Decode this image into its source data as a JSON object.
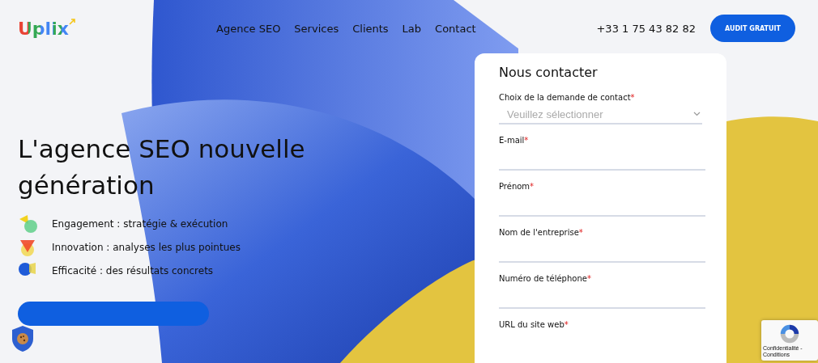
{
  "header": {
    "logo": "Uplix",
    "nav": [
      {
        "label": "Agence SEO"
      },
      {
        "label": "Services"
      },
      {
        "label": "Clients"
      },
      {
        "label": "Lab"
      },
      {
        "label": "Contact"
      }
    ],
    "phone": "+33 1 75 43 82 82",
    "cta": "AUDIT GRATUIT"
  },
  "hero": {
    "title": "L'agence SEO nouvelle génération",
    "bullets": [
      {
        "kind": "engagement",
        "text": "Engagement : stratégie & exécution"
      },
      {
        "kind": "innovation",
        "text": "Innovation : analyses les plus pointues"
      },
      {
        "kind": "efficacite",
        "text": "Efficacité : des résultats concrets"
      }
    ]
  },
  "form": {
    "title": "Nous contacter",
    "fields": [
      {
        "kind": "select",
        "label": "Choix de la demande de contact",
        "marker": "*",
        "placeholder": "Veuillez sélectionner"
      },
      {
        "kind": "text",
        "label": "E-mail",
        "marker": "*"
      },
      {
        "kind": "text",
        "label": "Prénom",
        "marker": "*"
      },
      {
        "kind": "text",
        "label": "Nom de l'entreprise",
        "marker": "*"
      },
      {
        "kind": "text",
        "label": "Numéro de téléphone",
        "marker": "*"
      },
      {
        "kind": "label",
        "label": "URL du site web",
        "marker": "*"
      }
    ]
  },
  "recaptcha": {
    "text": "Confidentialité - Conditions"
  }
}
